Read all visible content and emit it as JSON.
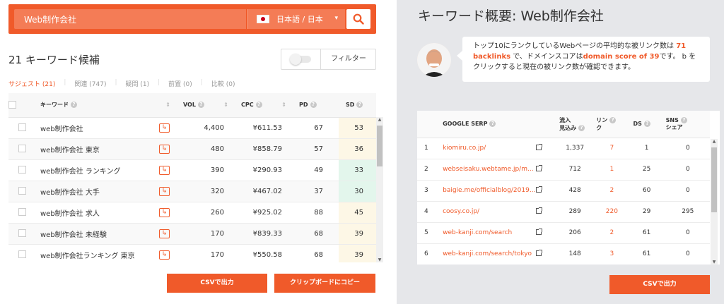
{
  "search": {
    "value": "Web制作会社",
    "language": "日本語 / 日本"
  },
  "keywords": {
    "count_label": "21 キーワード候補",
    "filter_label": "フィルター",
    "tabs": [
      {
        "label": "サジェスト (21)",
        "active": true
      },
      {
        "label": "関連 (747)",
        "active": false
      },
      {
        "label": "疑問 (1)",
        "active": false
      },
      {
        "label": "前置 (0)",
        "active": false
      },
      {
        "label": "比較 (0)",
        "active": false
      }
    ],
    "headers": {
      "keyword": "キーワード",
      "vol": "VOL",
      "cpc": "CPC",
      "pd": "PD",
      "sd": "SD"
    },
    "rows": [
      {
        "keyword": "web制作会社",
        "vol": "4,400",
        "cpc": "¥611.53",
        "pd": "67",
        "sd": "53",
        "sd_color": "#fdf7e6"
      },
      {
        "keyword": "web制作会社 東京",
        "vol": "480",
        "cpc": "¥858.79",
        "pd": "57",
        "sd": "36",
        "sd_color": "#fdf7e6"
      },
      {
        "keyword": "web制作会社 ランキング",
        "vol": "390",
        "cpc": "¥290.93",
        "pd": "49",
        "sd": "33",
        "sd_color": "#e3f6ec"
      },
      {
        "keyword": "web制作会社 大手",
        "vol": "320",
        "cpc": "¥467.02",
        "pd": "37",
        "sd": "30",
        "sd_color": "#e3f6ec"
      },
      {
        "keyword": "web制作会社 求人",
        "vol": "260",
        "cpc": "¥925.02",
        "pd": "88",
        "sd": "45",
        "sd_color": "#fdf7e6"
      },
      {
        "keyword": "web制作会社 未経験",
        "vol": "170",
        "cpc": "¥839.33",
        "pd": "68",
        "sd": "39",
        "sd_color": "#fdf7e6"
      },
      {
        "keyword": "web制作会社ランキング 東京",
        "vol": "170",
        "cpc": "¥550.58",
        "pd": "68",
        "sd": "39",
        "sd_color": "#fdf7e6"
      }
    ],
    "csv_label": "CSVで出力",
    "copy_label": "クリップボードにコピー"
  },
  "overview": {
    "title": "キーワード概要: Web制作会社",
    "bubble_parts": [
      {
        "text": "トップ10にランクしているWebページの平均的な被リンク数は ",
        "hl": false
      },
      {
        "text": "71 backlinks",
        "hl": true
      },
      {
        "text": " で、ドメインスコアは",
        "hl": false
      },
      {
        "text": "domain score of 39",
        "hl": true
      },
      {
        "text": "です。 b をクリックすると現在の被リンク数が確認できます。",
        "hl": false
      }
    ],
    "headers": {
      "serp": "GOOGLE SERP",
      "traffic_1": "流入",
      "traffic_2": "見込み",
      "links_1": "リン",
      "links_2": "ク",
      "ds": "DS",
      "sns_1": "SNS",
      "sns_2": "シェア"
    },
    "rows": [
      {
        "idx": "1",
        "url": "kiomiru.co.jp/",
        "traffic": "1,337",
        "links": "7",
        "ds": "1",
        "sns": "0"
      },
      {
        "idx": "2",
        "url": "webseisaku.webtame.jp/m...",
        "traffic": "712",
        "links": "1",
        "ds": "25",
        "sns": "0"
      },
      {
        "idx": "3",
        "url": "baigie.me/officialblog/2019...",
        "traffic": "428",
        "links": "2",
        "ds": "60",
        "sns": "0"
      },
      {
        "idx": "4",
        "url": "coosy.co.jp/",
        "traffic": "289",
        "links": "220",
        "ds": "29",
        "sns": "295"
      },
      {
        "idx": "5",
        "url": "web-kanji.com/search",
        "traffic": "206",
        "links": "2",
        "ds": "61",
        "sns": "0"
      },
      {
        "idx": "6",
        "url": "web-kanji.com/search/tokyo",
        "traffic": "148",
        "links": "3",
        "ds": "61",
        "sns": "0"
      }
    ],
    "csv_label": "CSVで出力"
  },
  "colors": {
    "accent": "#f05a2a"
  }
}
